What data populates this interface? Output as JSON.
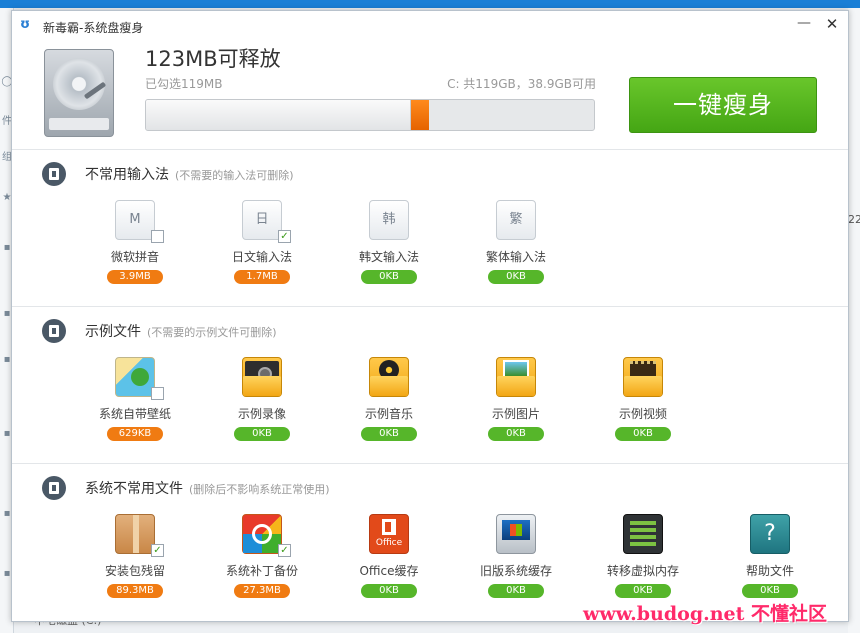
{
  "window": {
    "title": "新毒霸-系统盘瘦身",
    "minimize_label": "—",
    "close_label": "✕"
  },
  "header": {
    "release_title": "123MB可释放",
    "selected": "已勾选119MB",
    "disk_info": "C: 共119GB，38.9GB可用",
    "used_fraction": 0.632,
    "slim_button": "一键瘦身"
  },
  "sections": [
    {
      "title": "不常用输入法",
      "note": "(不需要的输入法可删除)",
      "items": [
        {
          "label": "微软拼音",
          "size": "3.9MB",
          "checked": false,
          "icon": "ime-m-icon",
          "glyph": "M"
        },
        {
          "label": "日文输入法",
          "size": "1.7MB",
          "checked": true,
          "icon": "ime-ri-icon",
          "glyph": "日"
        },
        {
          "label": "韩文输入法",
          "size": "0KB",
          "checked": false,
          "icon": "ime-han-icon",
          "glyph": "韩"
        },
        {
          "label": "繁体输入法",
          "size": "0KB",
          "checked": false,
          "icon": "ime-fan-icon",
          "glyph": "繁"
        }
      ]
    },
    {
      "title": "示例文件",
      "note": "(不需要的示例文件可删除)",
      "items": [
        {
          "label": "系统自带壁纸",
          "size": "629KB",
          "checked": false,
          "icon": "wallpaper-icon"
        },
        {
          "label": "示例录像",
          "size": "0KB",
          "checked": false,
          "icon": "video-folder-icon"
        },
        {
          "label": "示例音乐",
          "size": "0KB",
          "checked": false,
          "icon": "music-folder-icon"
        },
        {
          "label": "示例图片",
          "size": "0KB",
          "checked": false,
          "icon": "picture-folder-icon"
        },
        {
          "label": "示例视频",
          "size": "0KB",
          "checked": false,
          "icon": "movie-folder-icon"
        }
      ]
    },
    {
      "title": "系统不常用文件",
      "note": "(删除后不影响系统正常使用)",
      "items": [
        {
          "label": "安装包残留",
          "size": "89.3MB",
          "checked": true,
          "icon": "package-box-icon"
        },
        {
          "label": "系统补丁备份",
          "size": "27.3MB",
          "checked": true,
          "icon": "patch-backup-icon"
        },
        {
          "label": "Office缓存",
          "size": "0KB",
          "checked": false,
          "icon": "office-icon",
          "glyph": "Office"
        },
        {
          "label": "旧版系统缓存",
          "size": "0KB",
          "checked": false,
          "icon": "old-system-icon"
        },
        {
          "label": "转移虚拟内存",
          "size": "0KB",
          "checked": false,
          "icon": "virtual-memory-icon"
        },
        {
          "label": "帮助文件",
          "size": "0KB",
          "checked": false,
          "icon": "help-file-icon",
          "glyph": "?"
        }
      ]
    }
  ],
  "desktop": {
    "right_glyph": "22",
    "bottom_text": "中宅磁盘 (C:)"
  },
  "watermark": "www.budog.net 不懂社区",
  "colors": {
    "accent_green": "#56b62a",
    "size_orange": "#f07b12",
    "progress_marker": "#ff7a10",
    "title_bar_blue": "#1a7fd6"
  }
}
